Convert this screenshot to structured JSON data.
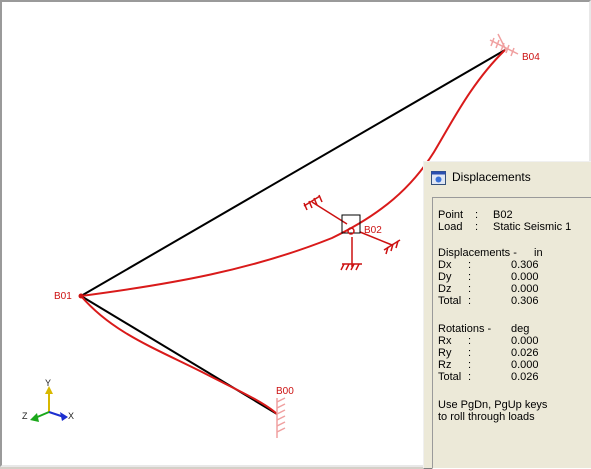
{
  "model": {
    "nodes": [
      {
        "id": "B04",
        "label": "B04"
      },
      {
        "id": "B02",
        "label": "B02"
      },
      {
        "id": "B01",
        "label": "B01"
      },
      {
        "id": "B00",
        "label": "B00"
      }
    ],
    "triad": {
      "x": "X",
      "y": "Y",
      "z": "Z"
    },
    "colors": {
      "undeformed": "#000000",
      "deformed": "#d91a1a",
      "supports": "#cc1111"
    }
  },
  "displacements_window": {
    "title": "Displacements",
    "icon": "window-app-icon",
    "point_label": "Point",
    "point_sep": ":",
    "point_value": "B02",
    "load_label": "Load",
    "load_sep": ":",
    "load_value": "Static Seismic 1",
    "disp_header": "Displacements -",
    "disp_unit": "in",
    "disp_rows": [
      {
        "label": "Dx",
        "sep": ":",
        "value": "0.306"
      },
      {
        "label": "Dy",
        "sep": ":",
        "value": "0.000"
      },
      {
        "label": "Dz",
        "sep": ":",
        "value": "0.000"
      },
      {
        "label": "Total",
        "sep": ":",
        "value": "0.306"
      }
    ],
    "rot_header": "Rotations -",
    "rot_unit": "deg",
    "rot_rows": [
      {
        "label": "Rx",
        "sep": ":",
        "value": "0.000"
      },
      {
        "label": "Ry",
        "sep": ":",
        "value": "0.026"
      },
      {
        "label": "Rz",
        "sep": ":",
        "value": "0.000"
      },
      {
        "label": "Total",
        "sep": ":",
        "value": "0.026"
      }
    ],
    "hint_line1": "Use PgDn, PgUp keys",
    "hint_line2": "to roll through loads"
  }
}
